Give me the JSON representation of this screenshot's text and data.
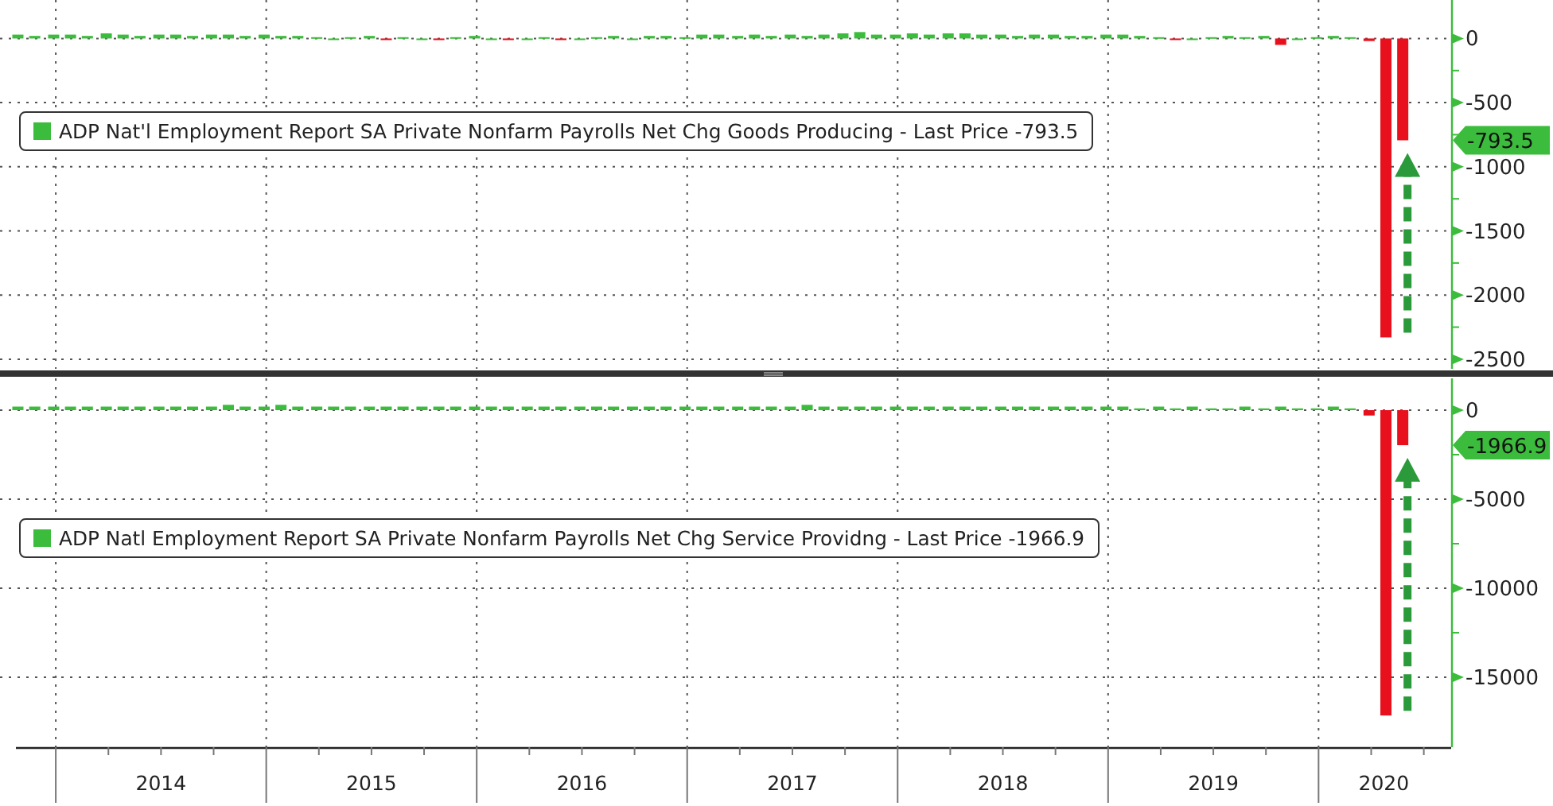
{
  "panels": [
    {
      "last_price": "-793.5",
      "chart_data": {
        "type": "bar",
        "xlim": [
          2013.735,
          2020.63
        ],
        "ylim": [
          -2575,
          300
        ],
        "grid": true,
        "x": [
          2013.82,
          2013.9,
          2013.99,
          2014.07,
          2014.15,
          2014.24,
          2014.32,
          2014.4,
          2014.49,
          2014.57,
          2014.65,
          2014.74,
          2014.82,
          2014.9,
          2014.99,
          2015.07,
          2015.15,
          2015.24,
          2015.32,
          2015.4,
          2015.49,
          2015.57,
          2015.65,
          2015.74,
          2015.82,
          2015.9,
          2015.99,
          2016.07,
          2016.15,
          2016.24,
          2016.32,
          2016.4,
          2016.49,
          2016.57,
          2016.65,
          2016.74,
          2016.82,
          2016.9,
          2016.99,
          2017.07,
          2017.15,
          2017.24,
          2017.32,
          2017.4,
          2017.49,
          2017.57,
          2017.65,
          2017.74,
          2017.82,
          2017.9,
          2017.99,
          2018.07,
          2018.15,
          2018.24,
          2018.32,
          2018.4,
          2018.49,
          2018.57,
          2018.65,
          2018.74,
          2018.82,
          2018.9,
          2018.99,
          2019.07,
          2019.15,
          2019.24,
          2019.32,
          2019.4,
          2019.49,
          2019.57,
          2019.65,
          2019.74,
          2019.82,
          2019.9,
          2019.99,
          2020.07,
          2020.15,
          2020.24,
          2020.32,
          2020.4
        ],
        "series": [
          {
            "name": "ADP Nat'l Employment Report SA Private Nonfarm Payrolls Net Chg Goods Producing - Last Price -793.5",
            "color": "#3cbc3c",
            "values": [
              30,
              20,
              30,
              30,
              20,
              40,
              30,
              20,
              30,
              30,
              20,
              30,
              30,
              20,
              30,
              20,
              20,
              10,
              0,
              10,
              20,
              null,
              10,
              0,
              null,
              10,
              20,
              0,
              null,
              0,
              10,
              null,
              0,
              10,
              20,
              0,
              20,
              20,
              10,
              30,
              30,
              20,
              30,
              20,
              30,
              20,
              30,
              40,
              50,
              30,
              30,
              40,
              30,
              40,
              40,
              30,
              30,
              20,
              30,
              30,
              20,
              20,
              30,
              30,
              20,
              10,
              null,
              0,
              10,
              20,
              10,
              20,
              null,
              0,
              10,
              20,
              10,
              null,
              null,
              null
            ]
          },
          {
            "color": "#e8101c",
            "values": [
              null,
              null,
              null,
              null,
              null,
              null,
              null,
              null,
              null,
              null,
              null,
              null,
              null,
              null,
              null,
              null,
              null,
              null,
              null,
              null,
              null,
              -10,
              null,
              null,
              -10,
              null,
              null,
              null,
              -10,
              null,
              null,
              -10,
              null,
              null,
              null,
              null,
              null,
              null,
              null,
              null,
              null,
              null,
              null,
              null,
              null,
              null,
              null,
              null,
              null,
              null,
              null,
              null,
              null,
              null,
              null,
              null,
              null,
              null,
              null,
              null,
              null,
              null,
              null,
              null,
              null,
              null,
              -10,
              null,
              null,
              null,
              null,
              null,
              -50,
              null,
              null,
              null,
              null,
              -20,
              -2330,
              -793.5
            ]
          }
        ],
        "yticks": [
          0,
          -500,
          -1000,
          -1500,
          -2000,
          -2500
        ]
      }
    },
    {
      "last_price": "-1966.9",
      "chart_data": {
        "type": "bar",
        "xlim": [
          2013.735,
          2020.63
        ],
        "ylim": [
          -18930,
          1786
        ],
        "grid": true,
        "x": [
          2013.82,
          2013.9,
          2013.99,
          2014.07,
          2014.15,
          2014.24,
          2014.32,
          2014.4,
          2014.49,
          2014.57,
          2014.65,
          2014.74,
          2014.82,
          2014.9,
          2014.99,
          2015.07,
          2015.15,
          2015.24,
          2015.32,
          2015.4,
          2015.49,
          2015.57,
          2015.65,
          2015.74,
          2015.82,
          2015.9,
          2015.99,
          2016.07,
          2016.15,
          2016.24,
          2016.32,
          2016.4,
          2016.49,
          2016.57,
          2016.65,
          2016.74,
          2016.82,
          2016.9,
          2016.99,
          2017.07,
          2017.15,
          2017.24,
          2017.32,
          2017.4,
          2017.49,
          2017.57,
          2017.65,
          2017.74,
          2017.82,
          2017.9,
          2017.99,
          2018.07,
          2018.15,
          2018.24,
          2018.32,
          2018.4,
          2018.49,
          2018.57,
          2018.65,
          2018.74,
          2018.82,
          2018.9,
          2018.99,
          2019.07,
          2019.15,
          2019.24,
          2019.32,
          2019.4,
          2019.49,
          2019.57,
          2019.65,
          2019.74,
          2019.82,
          2019.9,
          2019.99,
          2020.07,
          2020.15,
          2020.24,
          2020.32,
          2020.4
        ],
        "series": [
          {
            "name": "ADP Natl Employment Report SA Private Nonfarm Payrolls Net Chg Service Providng - Last Price -1966.9",
            "color": "#3cbc3c",
            "values": [
              200,
              200,
              200,
              200,
              200,
              200,
              200,
              200,
              200,
              200,
              200,
              200,
              300,
              200,
              200,
              300,
              200,
              200,
              200,
              200,
              200,
              200,
              200,
              200,
              200,
              200,
              200,
              200,
              200,
              200,
              200,
              200,
              200,
              200,
              200,
              200,
              200,
              200,
              200,
              200,
              200,
              200,
              200,
              200,
              200,
              300,
              200,
              200,
              200,
              200,
              200,
              200,
              200,
              200,
              200,
              200,
              200,
              200,
              200,
              200,
              200,
              200,
              200,
              200,
              100,
              200,
              100,
              200,
              100,
              100,
              200,
              100,
              200,
              100,
              100,
              200,
              100,
              null,
              null,
              null
            ]
          },
          {
            "color": "#e8101c",
            "values": [
              null,
              null,
              null,
              null,
              null,
              null,
              null,
              null,
              null,
              null,
              null,
              null,
              null,
              null,
              null,
              null,
              null,
              null,
              null,
              null,
              null,
              null,
              null,
              null,
              null,
              null,
              null,
              null,
              null,
              null,
              null,
              null,
              null,
              null,
              null,
              null,
              null,
              null,
              null,
              null,
              null,
              null,
              null,
              null,
              null,
              null,
              null,
              null,
              null,
              null,
              null,
              null,
              null,
              null,
              null,
              null,
              null,
              null,
              null,
              null,
              null,
              null,
              null,
              null,
              null,
              null,
              null,
              null,
              null,
              null,
              null,
              null,
              null,
              null,
              null,
              null,
              null,
              -300,
              -17150,
              -1966.9
            ]
          }
        ],
        "yticks": [
          0,
          -5000,
          -10000,
          -15000
        ],
        "xticks": [
          {
            "value": 2014.5,
            "label": "2014"
          },
          {
            "value": 2015.5,
            "label": "2015"
          },
          {
            "value": 2016.5,
            "label": "2016"
          },
          {
            "value": 2017.5,
            "label": "2017"
          },
          {
            "value": 2018.5,
            "label": "2018"
          },
          {
            "value": 2019.5,
            "label": "2019"
          },
          {
            "value": 2020.31,
            "label": "2020"
          }
        ]
      }
    }
  ]
}
